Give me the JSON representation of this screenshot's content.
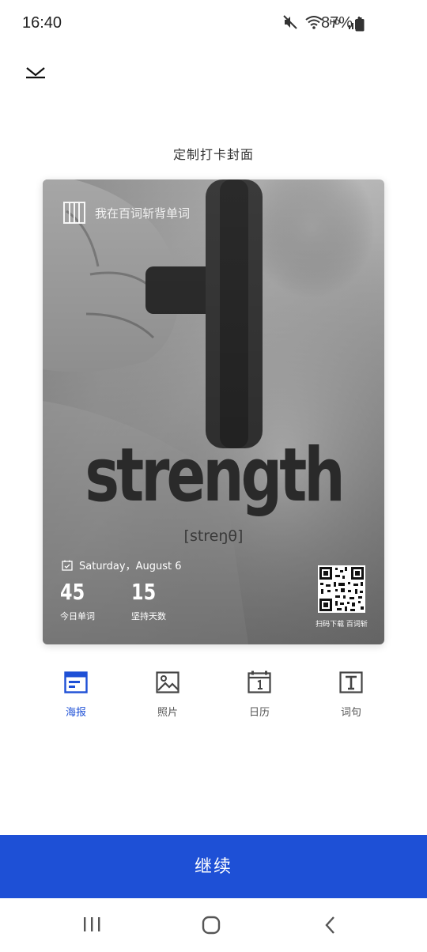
{
  "status_bar": {
    "time": "16:40",
    "network": "HD",
    "network_gen": "5G",
    "battery": "87%",
    "icons": [
      "mute-icon",
      "wifi-icon",
      "signal-icon",
      "battery-icon"
    ]
  },
  "header": {
    "close_icon": "chevron-down-icon",
    "title": "定制打卡封面"
  },
  "poster": {
    "brand_text": "我在百词斩背单词",
    "word": "strength",
    "phonetic": "[streŋθ]",
    "date": "Saturday，August 6",
    "stats": [
      {
        "value": "45",
        "label": "今日单词"
      },
      {
        "value": "15",
        "label": "坚持天数"
      }
    ],
    "qr_caption": "扫码下载 百词斩",
    "background": "grayscale-photo"
  },
  "tabs": [
    {
      "label": "海报",
      "icon": "poster-icon",
      "active": true
    },
    {
      "label": "照片",
      "icon": "image-icon",
      "active": false
    },
    {
      "label": "日历",
      "icon": "calendar-icon",
      "active": false
    },
    {
      "label": "词句",
      "icon": "text-icon",
      "active": false
    }
  ],
  "continue_label": "继续",
  "nav": {
    "recent": "recent-apps-icon",
    "home": "home-icon",
    "back": "back-icon"
  },
  "colors": {
    "accent": "#1e50d6",
    "text": "#333333",
    "inactive": "#555555"
  }
}
